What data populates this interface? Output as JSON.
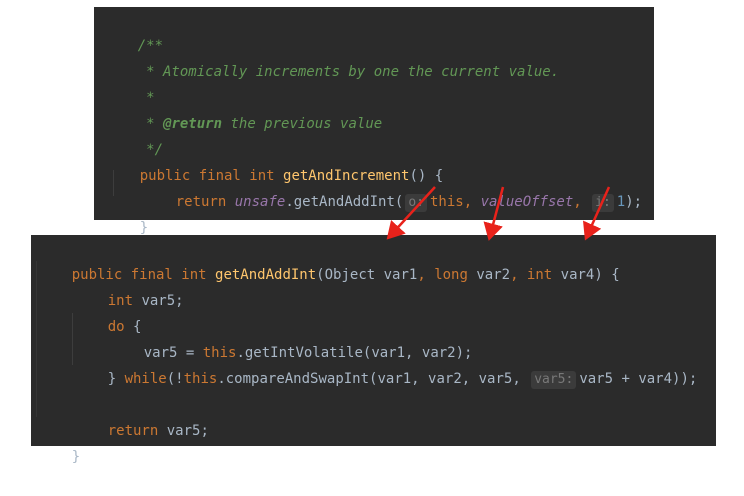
{
  "doc": {
    "open": "/**",
    "line1": " * Atomically increments by one the current value.",
    "star": " *",
    "tag_prefix": " * ",
    "return_tag": "@return",
    "return_text": " the previous value",
    "close": " */"
  },
  "method1": {
    "modifiers": "public final int ",
    "name": "getAndIncrement",
    "sig_rest": "() {",
    "return_kw": "return ",
    "receiver": "unsafe",
    "call": ".getAndAddInt(",
    "hint_o": "o:",
    "arg_this": "this",
    "comma1": ", ",
    "arg_offset": "valueOffset",
    "comma2": ", ",
    "hint_i": "i:",
    "arg_one": "1",
    "call_end": ");",
    "close_brace": "}"
  },
  "method2": {
    "modifiers": "public final int ",
    "name": "getAndAddInt",
    "p1_type": "(Object var1",
    "comma": ", ",
    "p2_type": "long",
    "p2_name": " var2",
    "p3_type": "int",
    "p3_name": " var4) {",
    "decl_type": "int",
    "decl_name": " var5;",
    "do_kw": "do",
    "do_brace": " {",
    "assign": "var5 = ",
    "this_kw": "this",
    "get_call": ".getIntVolatile(var1, var2);",
    "close_do": "} ",
    "while_kw": "while",
    "not": "(!",
    "this_kw2": "this",
    "cas_call": ".compareAndSwapInt(var1, var2, var5, ",
    "hint_var5": "var5:",
    "cas_rest": "var5 + var4));",
    "return_kw": "return",
    "return_rest": " var5;",
    "close_brace": "}"
  },
  "colors": {
    "background": "#2b2b2b",
    "keyword": "#cc7832",
    "method_name": "#ffc66d",
    "comment": "#629755",
    "field": "#9876aa",
    "number": "#6897bb",
    "arrow": "#e8221b"
  }
}
